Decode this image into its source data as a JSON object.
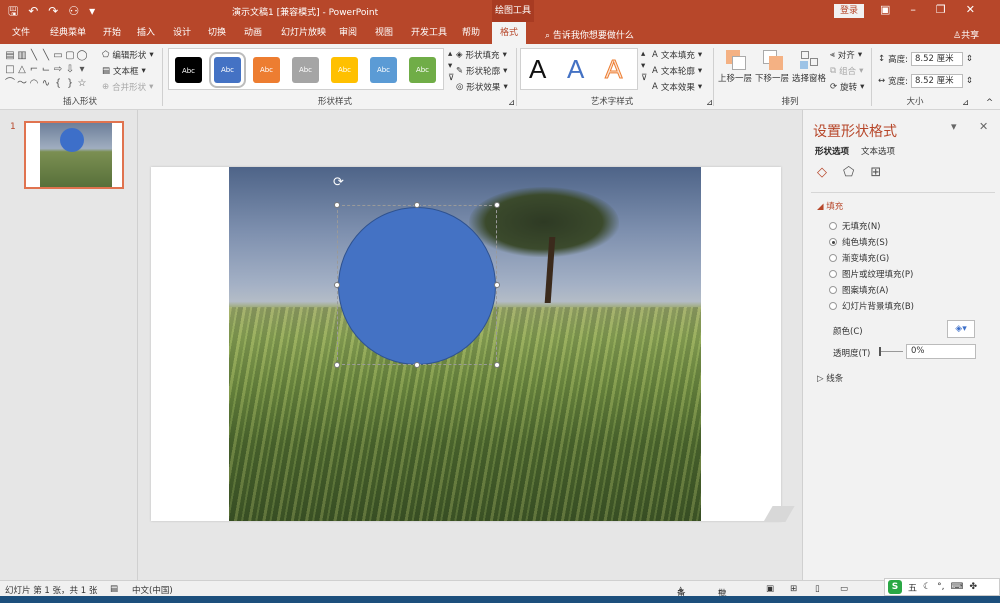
{
  "titlebar": {
    "doc_title": "演示文稿1 [兼容模式] - PowerPoint",
    "tool_context": "绘图工具",
    "login": "登录"
  },
  "tabs": {
    "items": [
      "文件",
      "经典菜单",
      "开始",
      "插入",
      "设计",
      "切换",
      "动画",
      "幻灯片放映",
      "审阅",
      "视图",
      "开发工具",
      "帮助",
      "格式"
    ],
    "active": "格式",
    "tellme": "告诉我你想要做什么",
    "share": "共享"
  },
  "ribbon": {
    "insert_shapes": {
      "edit_shape": "编辑形状",
      "text_box": "文本框",
      "merge_shapes": "合并形状",
      "label": "插入形状"
    },
    "shape_styles": {
      "swatch_text": "Abc",
      "swatch_colors": [
        "#000000",
        "#4472c4",
        "#ed7d31",
        "#a5a5a5",
        "#ffc000",
        "#5b9bd5",
        "#70ad47"
      ],
      "fill": "形状填充",
      "outline": "形状轮廓",
      "effects": "形状效果",
      "label": "形状样式"
    },
    "wordart": {
      "letter": "A",
      "text_fill": "文本填充",
      "text_outline": "文本轮廓",
      "text_effects": "文本效果",
      "label": "艺术字样式"
    },
    "arrange": {
      "bring_forward": "上移一层",
      "send_backward": "下移一层",
      "selection_pane": "选择窗格",
      "align": "对齐",
      "group": "组合",
      "rotate": "旋转",
      "label": "排列"
    },
    "size": {
      "height_label": "高度:",
      "height_value": "8.52 厘米",
      "width_label": "宽度:",
      "width_value": "8.52 厘米",
      "label": "大小"
    }
  },
  "thumbnails": {
    "slide_number": "1"
  },
  "format_pane": {
    "title": "设置形状格式",
    "tab_shape": "形状选项",
    "tab_text": "文本选项",
    "fill_section": "填充",
    "options": [
      {
        "label": "无填充(N)",
        "checked": false
      },
      {
        "label": "纯色填充(S)",
        "checked": true
      },
      {
        "label": "渐变填充(G)",
        "checked": false
      },
      {
        "label": "图片或纹理填充(P)",
        "checked": false
      },
      {
        "label": "图案填充(A)",
        "checked": false
      },
      {
        "label": "幻灯片背景填充(B)",
        "checked": false
      }
    ],
    "color_label": "颜色(C)",
    "transparency_label": "透明度(T)",
    "transparency_value": "0%",
    "line_section": "线条"
  },
  "statusbar": {
    "slide_info": "幻灯片 第 1 张，共 1 张",
    "language": "中文(中国)",
    "notes": "备注",
    "comments": "批注"
  },
  "ime": {
    "mode": "五"
  },
  "colors": {
    "accent": "#b7472a",
    "shape_fill": "#4472c4"
  }
}
